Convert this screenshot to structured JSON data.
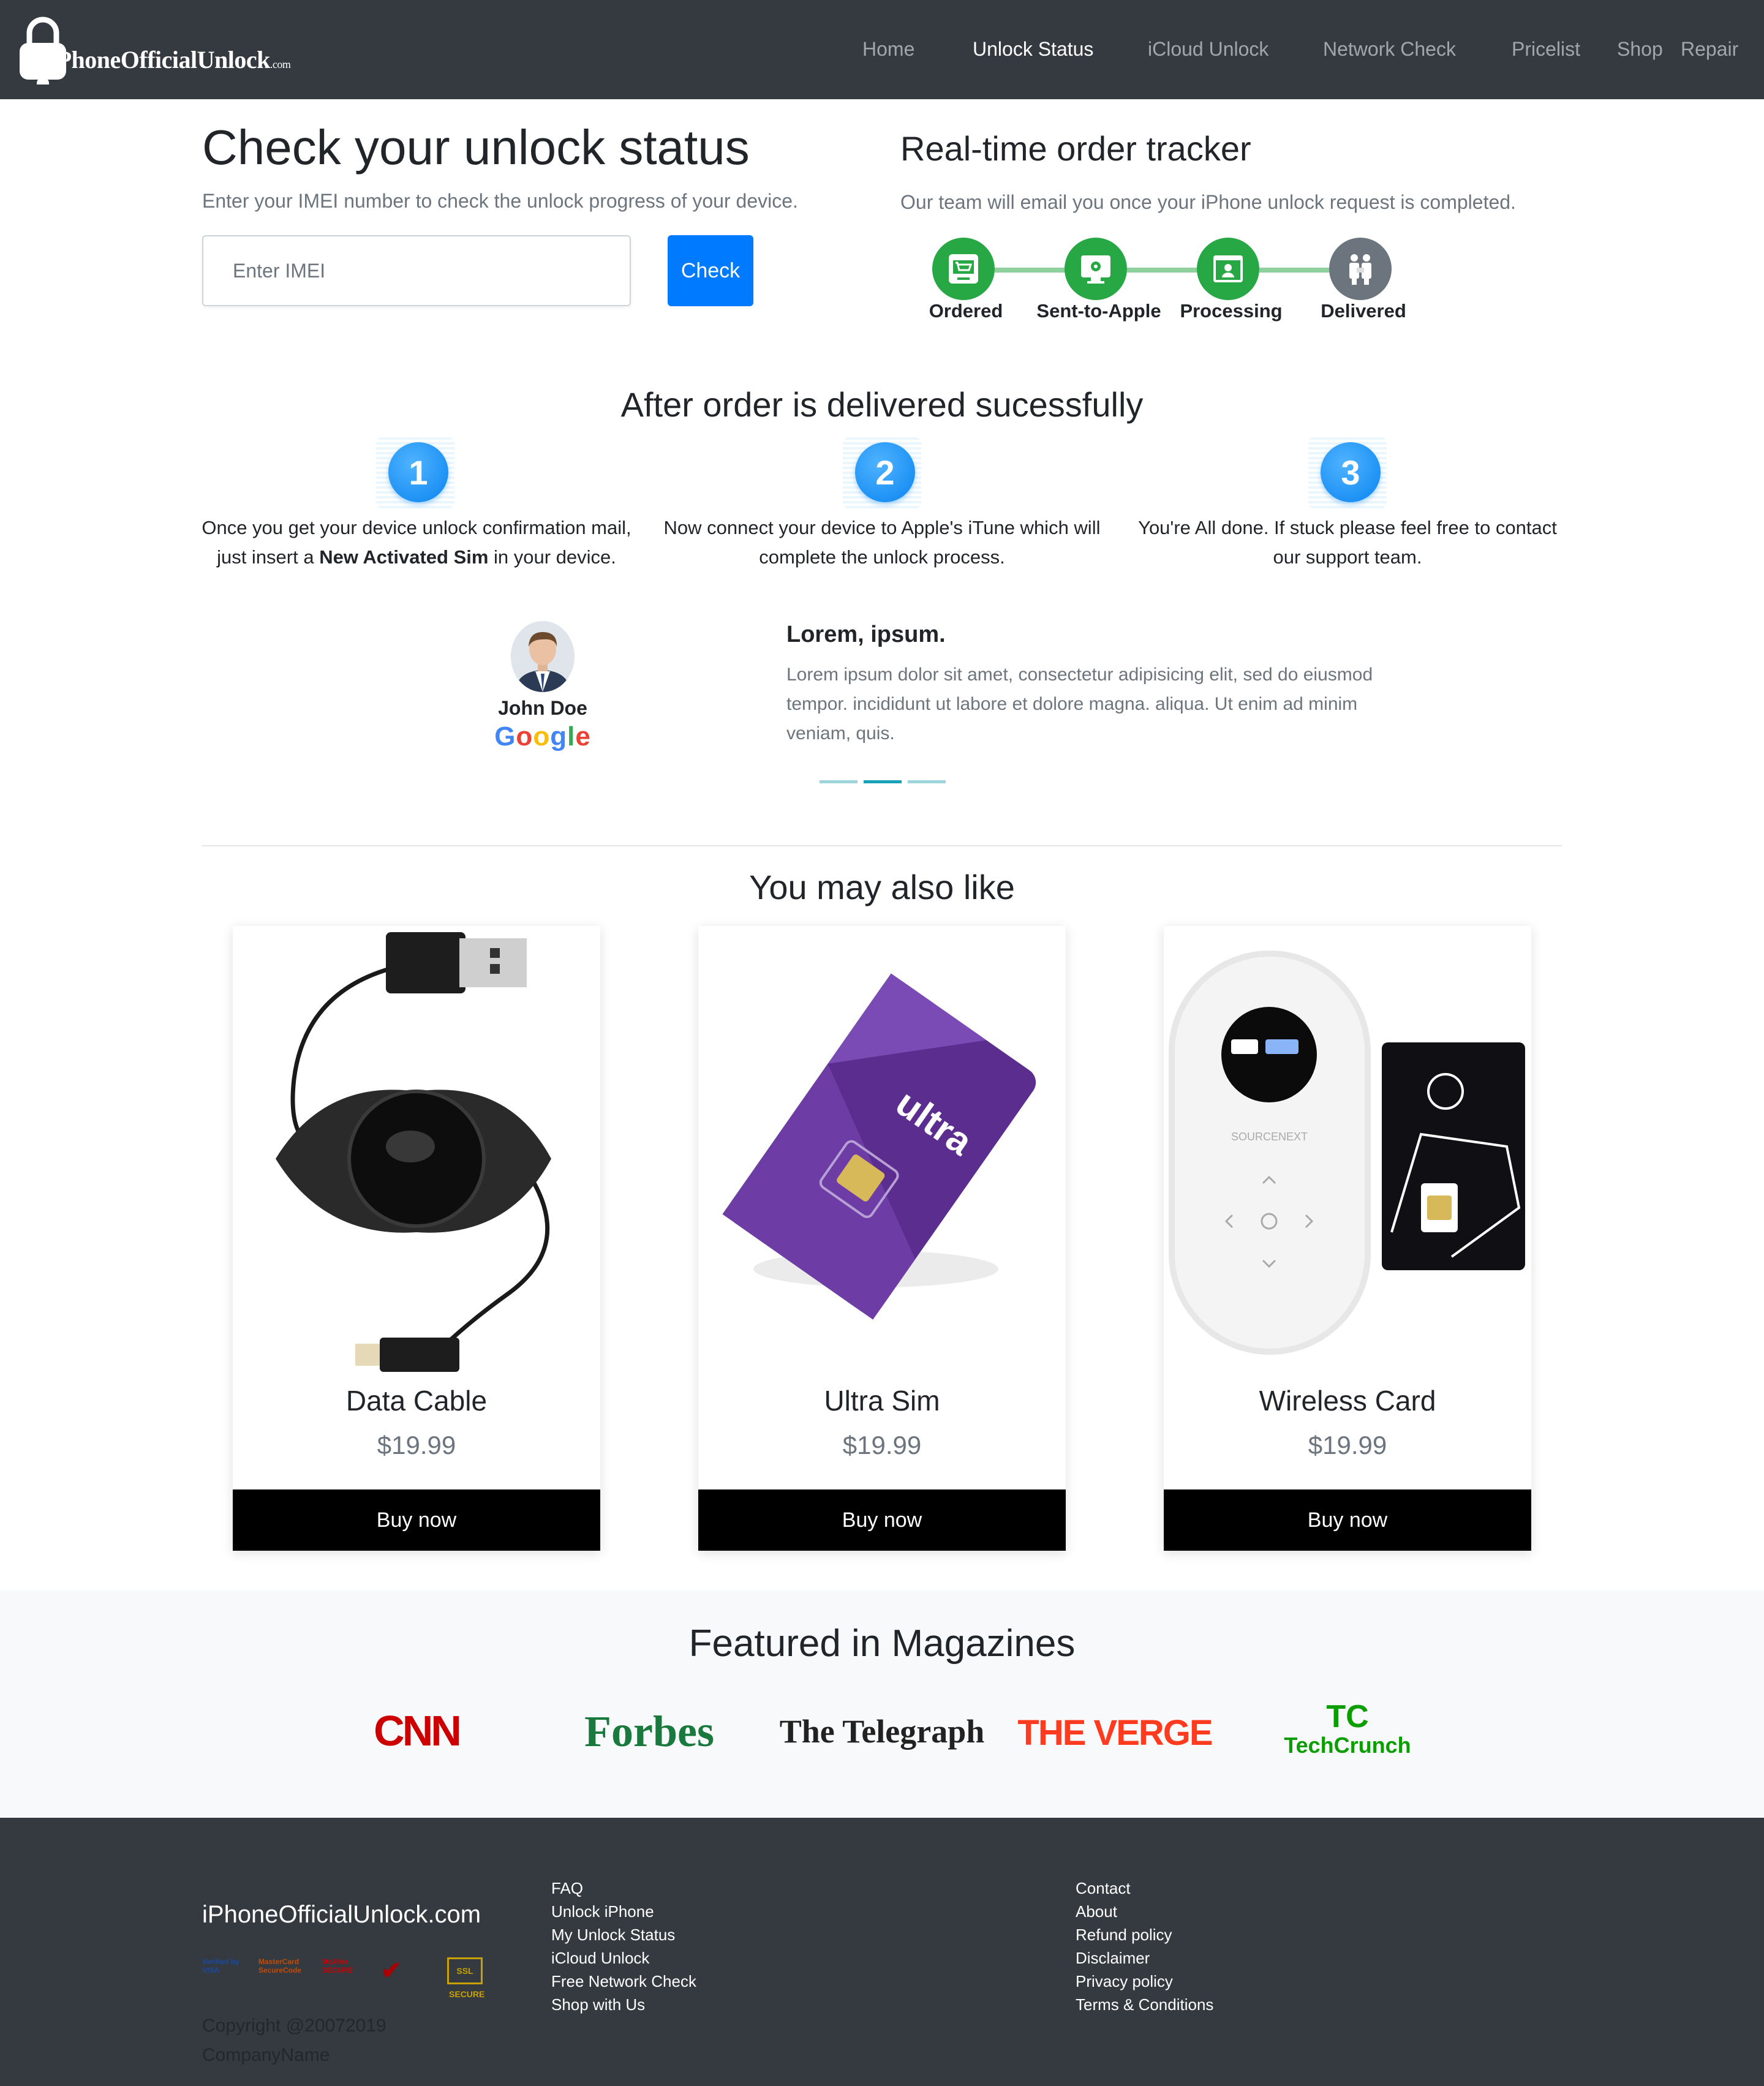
{
  "nav": {
    "brand": "iPhoneOfficialUnlock",
    "brand_suffix": ".com",
    "items": [
      {
        "label": "Home"
      },
      {
        "label": "Unlock Status",
        "active": true
      },
      {
        "label": "iCloud Unlock"
      },
      {
        "label": "Network Check"
      },
      {
        "label": "Pricelist"
      },
      {
        "label": "Shop"
      },
      {
        "label": "Repair"
      }
    ]
  },
  "hero": {
    "title": "Check your unlock status",
    "subtitle": "Enter your IMEI number to check the unlock progress of your device.",
    "imei_placeholder": "Enter IMEI",
    "check_label": "Check"
  },
  "tracker": {
    "title": "Real-time order tracker",
    "subtitle": "Our team will email you once your iPhone unlock request is completed.",
    "steps": [
      {
        "label": "Ordered",
        "status": "complete",
        "color": "#28a745"
      },
      {
        "label": "Sent-to-Apple",
        "status": "complete",
        "color": "#28a745"
      },
      {
        "label": "Processing",
        "status": "complete",
        "color": "#28a745"
      },
      {
        "label": "Delivered",
        "status": "pending",
        "color": "#6c757d"
      }
    ]
  },
  "after": {
    "title": "After order is delivered sucessfully",
    "steps": [
      {
        "num": "1",
        "text_pre": "Once you get your device unlock confirmation mail, just insert a ",
        "text_bold": "New Activated Sim",
        "text_post": " in your device."
      },
      {
        "num": "2",
        "text": "Now connect your device to Apple's iTune which will complete the unlock process."
      },
      {
        "num": "3",
        "text": "You're All done. If stuck please feel free to contact our support team."
      }
    ]
  },
  "testimonial": {
    "name": "John Doe",
    "company": "Google",
    "title": "Lorem, ipsum.",
    "body": "Lorem ipsum dolor sit amet, consectetur adipisicing elit, sed do eiusmod tempor. incididunt ut labore et dolore magna. aliqua. Ut enim ad minim veniam, quis.",
    "active_slide": 2,
    "slides": 3
  },
  "shop": {
    "title": "You may also like",
    "products": [
      {
        "name": "Data Cable",
        "price": "$19.99",
        "button": "Buy now"
      },
      {
        "name": "Ultra Sim",
        "price": "$19.99",
        "button": "Buy now"
      },
      {
        "name": "Wireless Card",
        "price": "$19.99",
        "button": "Buy now"
      }
    ]
  },
  "magazines": {
    "title": "Featured in Magazines",
    "logos": [
      "CNN",
      "Forbes",
      "The Telegraph",
      "THE VERGE",
      "TechCrunch"
    ]
  },
  "footer": {
    "brand": "iPhoneOfficialUnlock.com",
    "badges": [
      "Verified by VISA",
      "MasterCard SecureCode",
      "McAfee SECURE",
      "Norton",
      "SSL SECURE"
    ],
    "copyright": "Copyright @20072019",
    "company": "CompanyName",
    "col1": [
      "FAQ",
      "Unlock iPhone",
      "My Unlock Status",
      "iCloud Unlock",
      "Free Network Check",
      "Shop with Us"
    ],
    "col2": [
      "Contact",
      "About",
      "Refund policy",
      "Disclaimer",
      "Privacy policy",
      "Terms & Conditions"
    ]
  },
  "colors": {
    "nav_bg": "#343a40",
    "primary": "#007bff",
    "success": "#28a745",
    "info": "#17a2b8"
  }
}
